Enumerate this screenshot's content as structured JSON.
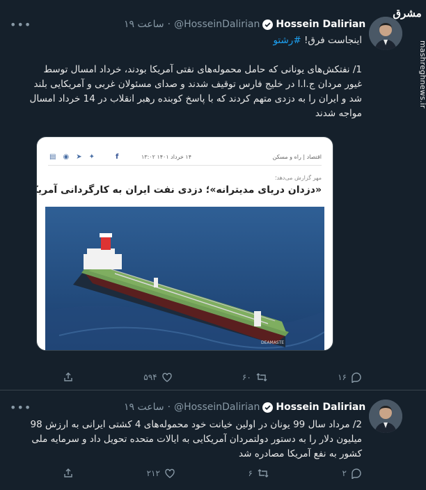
{
  "watermark": {
    "logo": "مشرق",
    "url": "mashreghnews.ir"
  },
  "tweets": [
    {
      "name": "Hossein Dalirian",
      "handle": "@HosseinDalirian",
      "time": "۱۹ ساعت",
      "intro": "اینجاست فرق!",
      "hashtag": "#رشتو",
      "body": "1/ نفتکش‌های یونانی که حامل محموله‌های نفتی آمریکا بودند، خرداد امسال توسط غیور مردان ج.ا.ا در خلیج فارس توقیف شدند و صدای مسئولان غربی و آمریکایی بلند شد و ایران را به دزدی متهم کردند که با پاسخ کوبنده رهبر انقلاب در 14 خرداد امسال مواجه شدند",
      "stats": {
        "replies": "۱۶",
        "retweets": "۶۰",
        "likes": "۵۹۴"
      }
    },
    {
      "name": "Hossein Dalirian",
      "handle": "@HosseinDalirian",
      "time": "۱۹ ساعت",
      "body": "2/ مرداد سال 99 یونان در اولین خیانت خود محموله‌های 4 کشتی ایرانی به ارزش 98 میلیون دلار را به دستور دولتمردان آمریکایی به ایالات متحده تحویل داد و سرمایه ملی کشور به نفع آمریکا مصادره شد",
      "stats": {
        "replies": "۲",
        "retweets": "۶",
        "likes": "۲۱۲"
      }
    }
  ],
  "article": {
    "breadcrumb": "اقتصاد | راه و مسکن",
    "date": "۱۴ خرداد ۱۴۰۱ ۱۳:۰۲",
    "kicker": "مهر گزارش می‌دهد؛",
    "headline": "«دزدان دریای مدیترانه»؛ دزدی نفت ایران به کارگردانی آمریکا",
    "ship_label": "DEAMASTE"
  },
  "colors": {
    "background": "#15202b",
    "accent": "#1da1f2",
    "muted": "#8899a6"
  }
}
